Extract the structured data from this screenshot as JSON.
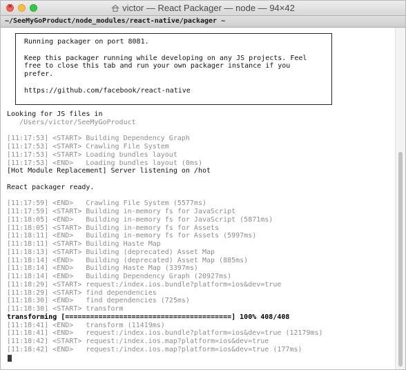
{
  "window": {
    "title": "victor — React Packager — node — 94×42",
    "close_glyph": "✕"
  },
  "tab": {
    "label": "~/SeeMyGoProduct/node_modules/react-native/packager ~"
  },
  "banner": {
    "lines": [
      "Running packager on port 8081.",
      "",
      "Keep this packager running while developing on any JS projects. Feel",
      "free to close this tab and run your own packager instance if you",
      "prefer.",
      "",
      "https://github.com/facebook/react-native"
    ]
  },
  "log": {
    "lines": [
      "Looking for JS files in",
      "   /Users/victor/SeeMyGoProduct",
      "",
      "[11:17:53] <START> Building Dependency Graph",
      "[11:17:53] <START> Crawling File System",
      "[11:17:53] <START> Loading bundles layout",
      "[11:17:53] <END>   Loading bundles layout (0ms)",
      "[Hot Module Replacement] Server listening on /hot",
      "",
      "React packager ready.",
      "",
      "[11:17:59] <END>   Crawling File System (5577ms)",
      "[11:17:59] <START> Building in-memory fs for JavaScript",
      "[11:18:05] <END>   Building in-memory fs for JavaScript (5871ms)",
      "[11:18:05] <START> Building in-memory fs for Assets",
      "[11:18:11] <END>   Building in-memory fs for Assets (5997ms)",
      "[11:18:11] <START> Building Haste Map",
      "[11:18:13] <START> Building (deprecated) Asset Map",
      "[11:18:14] <END>   Building (deprecated) Asset Map (885ms)",
      "[11:18:14] <END>   Building Haste Map (3397ms)",
      "[11:18:14] <END>   Building Dependency Graph (20927ms)",
      "[11:18:29] <START> request:/index.ios.bundle?platform=ios&dev=true",
      "[11:18:29] <START> find dependencies",
      "[11:18:30] <END>   find dependencies (725ms)",
      "[11:18:30] <START> transform",
      "transforming [========================================] 100% 408/408",
      "[11:18:41] <END>   transform (11419ms)",
      "[11:18:41] <END>   request:/index.ios.bundle?platform=ios&dev=true (12179ms)",
      "[11:18:42] <START> request:/index.ios.map?platform=ios&dev=true",
      "[11:18:42] <END>   request:/index.ios.map?platform=ios&dev=true (177ms)"
    ]
  },
  "icons": {
    "titlebar": "house-icon"
  }
}
